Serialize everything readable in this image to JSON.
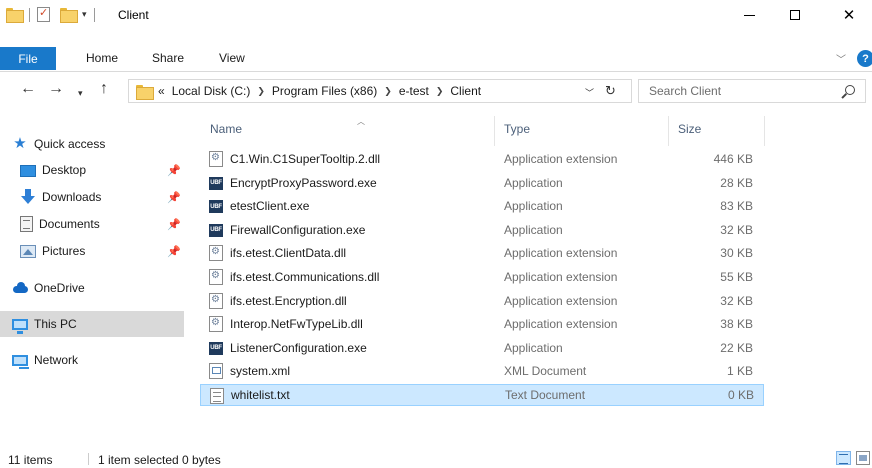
{
  "window": {
    "title": "Client",
    "qat_arrow": "▾"
  },
  "ribbon": {
    "tabs": [
      {
        "label": "File"
      },
      {
        "label": "Home"
      },
      {
        "label": "Share"
      },
      {
        "label": "View"
      }
    ]
  },
  "address": {
    "overflow": "«",
    "crumbs": [
      "Local Disk (C:)",
      "Program Files (x86)",
      "e-test",
      "Client"
    ]
  },
  "search": {
    "placeholder": "Search Client"
  },
  "navpane": {
    "items": [
      {
        "label": "Quick access",
        "icon": "star-icon"
      },
      {
        "label": "Desktop",
        "icon": "desktop-icon",
        "pinned": true
      },
      {
        "label": "Downloads",
        "icon": "downloads-icon",
        "pinned": true
      },
      {
        "label": "Documents",
        "icon": "documents-icon",
        "pinned": true
      },
      {
        "label": "Pictures",
        "icon": "pictures-icon",
        "pinned": true
      },
      {
        "label": "OneDrive",
        "icon": "onedrive-icon"
      },
      {
        "label": "This PC",
        "icon": "this-pc-icon",
        "selected": true
      },
      {
        "label": "Network",
        "icon": "network-icon"
      }
    ]
  },
  "columns": {
    "name": "Name",
    "type": "Type",
    "size": "Size"
  },
  "files": [
    {
      "name": "C1.Win.C1SuperTooltip.2.dll",
      "type": "Application extension",
      "size": "446 KB",
      "icon": "dll-icon"
    },
    {
      "name": "EncryptProxyPassword.exe",
      "type": "Application",
      "size": "28 KB",
      "icon": "exe-icon"
    },
    {
      "name": "etestClient.exe",
      "type": "Application",
      "size": "83 KB",
      "icon": "exe-icon"
    },
    {
      "name": "FirewallConfiguration.exe",
      "type": "Application",
      "size": "32 KB",
      "icon": "exe-icon"
    },
    {
      "name": "ifs.etest.ClientData.dll",
      "type": "Application extension",
      "size": "30 KB",
      "icon": "dll-icon"
    },
    {
      "name": "ifs.etest.Communications.dll",
      "type": "Application extension",
      "size": "55 KB",
      "icon": "dll-icon"
    },
    {
      "name": "ifs.etest.Encryption.dll",
      "type": "Application extension",
      "size": "32 KB",
      "icon": "dll-icon"
    },
    {
      "name": "Interop.NetFwTypeLib.dll",
      "type": "Application extension",
      "size": "38 KB",
      "icon": "dll-icon"
    },
    {
      "name": "ListenerConfiguration.exe",
      "type": "Application",
      "size": "22 KB",
      "icon": "exe-icon"
    },
    {
      "name": "system.xml",
      "type": "XML Document",
      "size": "1 KB",
      "icon": "xml-icon"
    },
    {
      "name": "whitelist.txt",
      "type": "Text Document",
      "size": "0 KB",
      "icon": "txt-icon",
      "selected": true
    }
  ],
  "status": {
    "count": "11 items",
    "selection": "1 item selected  0 bytes"
  },
  "colors": {
    "accent": "#1979ca",
    "selection_bg": "#cce8ff",
    "selection_border": "#99d1ff",
    "nav_selected": "#d9d9d9"
  }
}
